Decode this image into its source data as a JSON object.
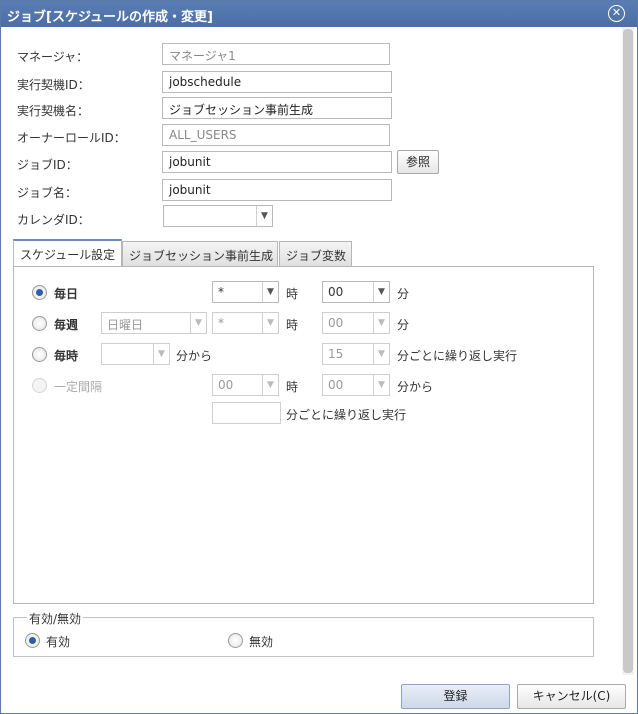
{
  "window": {
    "title": "ジョブ[スケジュールの作成・変更]",
    "close_symbol": "✕"
  },
  "form": {
    "manager_label": "マネージャ：",
    "manager_value": "マネージャ1",
    "schedule_id_label": "実行契機ID：",
    "schedule_id_value": "jobschedule",
    "schedule_name_label": "実行契機名：",
    "schedule_name_value": "ジョブセッション事前生成",
    "owner_role_label": "オーナーロールID：",
    "owner_role_value": "ALL_USERS",
    "job_id_label": "ジョブID：",
    "job_id_value": "jobunit",
    "reference_button": "参照",
    "job_name_label": "ジョブ名：",
    "job_name_value": "jobunit",
    "calendar_label": "カレンダID：",
    "calendar_value": ""
  },
  "tabs": [
    {
      "label": "スケジュール設定",
      "active": true
    },
    {
      "label": "ジョブセッション事前生成",
      "active": false
    },
    {
      "label": "ジョブ変数",
      "active": false
    }
  ],
  "schedule": {
    "daily": {
      "label": "毎日",
      "selected": true,
      "hour": "*",
      "minute": "00"
    },
    "weekly": {
      "label": "毎週",
      "selected": false,
      "day": "日曜日",
      "hour": "*",
      "minute": "00"
    },
    "hourly": {
      "label": "毎時",
      "selected": false,
      "from": "",
      "interval": "15"
    },
    "interval": {
      "label": "一定間隔",
      "selected": false,
      "hour": "00",
      "minute": "00",
      "repeat": ""
    },
    "unit_hour": "時",
    "unit_minute": "分",
    "from_minutes": "分から",
    "repeat_every": "分ごとに繰り返し実行"
  },
  "validity": {
    "legend": "有効/無効",
    "valid_label": "有効",
    "valid_selected": true,
    "invalid_label": "無効",
    "invalid_selected": false
  },
  "footer": {
    "register_button": "登録",
    "cancel_button": "キャンセル(C)"
  },
  "icons": {
    "dropdown": "▼"
  }
}
